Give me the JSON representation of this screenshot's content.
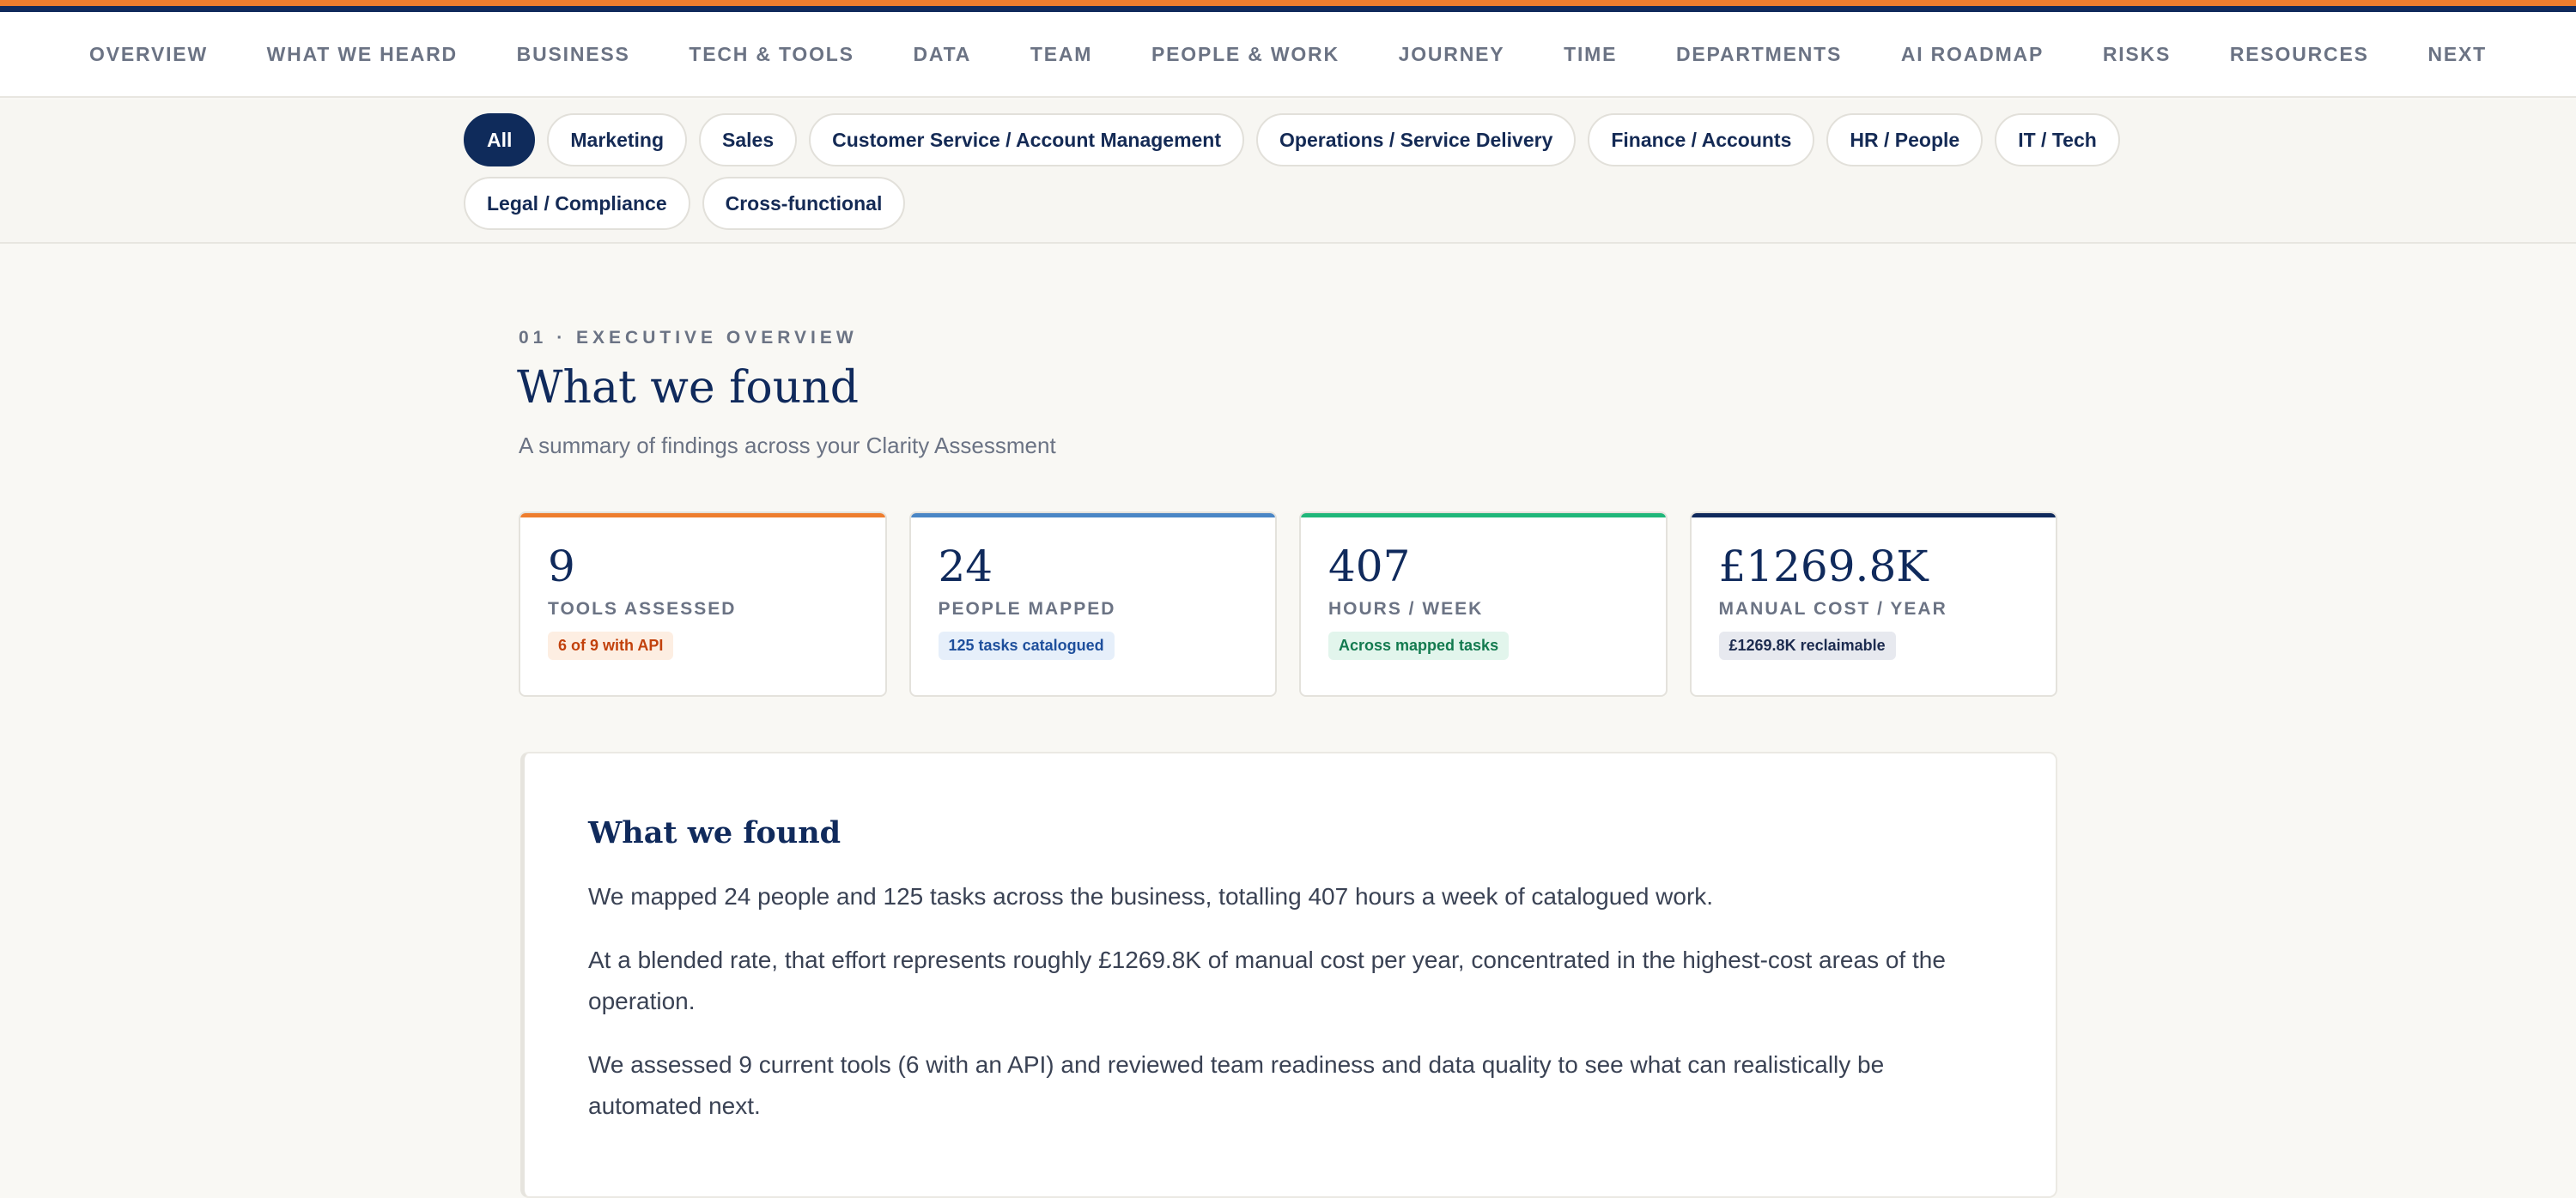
{
  "colors": {
    "orange": "#ee7d2e",
    "navy": "#102a5c",
    "blue": "#4a86c5",
    "green": "#20b77a"
  },
  "nav": {
    "items": [
      "OVERVIEW",
      "WHAT WE HEARD",
      "BUSINESS",
      "TECH & TOOLS",
      "DATA",
      "TEAM",
      "PEOPLE & WORK",
      "JOURNEY",
      "TIME",
      "DEPARTMENTS",
      "AI ROADMAP",
      "RISKS",
      "RESOURCES",
      "NEXT"
    ]
  },
  "filters": {
    "active": "All",
    "chips": [
      "All",
      "Marketing",
      "Sales",
      "Customer Service / Account Management",
      "Operations / Service Delivery",
      "Finance / Accounts",
      "HR / People",
      "IT / Tech",
      "Legal / Compliance",
      "Cross-functional"
    ]
  },
  "section": {
    "eyebrow": "01 · EXECUTIVE OVERVIEW",
    "title": "What we found",
    "subtitle": "A summary of findings across your Clarity Assessment"
  },
  "stats": [
    {
      "value": "9",
      "label": "TOOLS ASSESSED",
      "badge": "6 of 9 with API",
      "accent": "#ee7d2e",
      "badge_bg": "#fdeee2",
      "badge_fg": "#c2410c"
    },
    {
      "value": "24",
      "label": "PEOPLE MAPPED",
      "badge": "125 tasks catalogued",
      "accent": "#4a86c5",
      "badge_bg": "#e6effa",
      "badge_fg": "#1e4f9c"
    },
    {
      "value": "407",
      "label": "HOURS / WEEK",
      "badge": "Across mapped tasks",
      "accent": "#20b77a",
      "badge_bg": "#e2f5ec",
      "badge_fg": "#137a4f"
    },
    {
      "value": "£1269.8K",
      "label": "MANUAL COST / YEAR",
      "badge": "£1269.8K reclaimable",
      "accent": "#102a5c",
      "badge_bg": "#e7e9ef",
      "badge_fg": "#1c2b4f"
    }
  ],
  "finding": {
    "heading": "What we found",
    "paragraphs": [
      "We mapped 24 people and 125 tasks across the business, totalling 407 hours a week of catalogued work.",
      "At a blended rate, that effort represents roughly £1269.8K of manual cost per year, concentrated in the highest-cost areas of the operation.",
      "We assessed 9 current tools (6 with an API) and reviewed team readiness and data quality to see what can realistically be automated next."
    ]
  }
}
